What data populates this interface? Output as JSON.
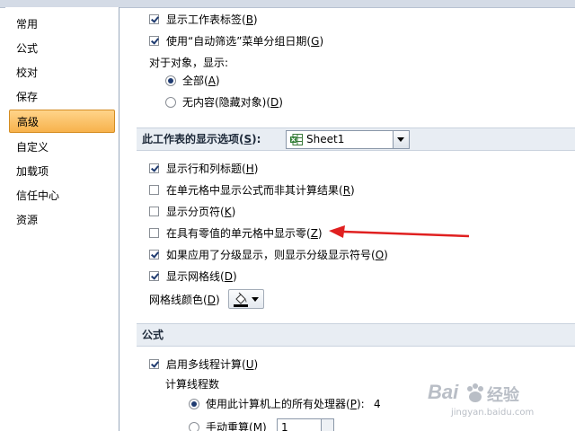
{
  "sidebar": {
    "items": [
      {
        "label": "常用"
      },
      {
        "label": "公式"
      },
      {
        "label": "校对"
      },
      {
        "label": "保存"
      },
      {
        "label": "高级",
        "active": true
      },
      {
        "label": "自定义"
      },
      {
        "label": "加载项"
      },
      {
        "label": "信任中心"
      },
      {
        "label": "资源"
      }
    ]
  },
  "workbook_options": {
    "show_sheet_tabs": {
      "text": "显示工作表标签(",
      "key": "B",
      "end": ")",
      "checked": true
    },
    "group_dates": {
      "text": "使用“自动筛选”菜单分组日期(",
      "key": "G",
      "end": ")",
      "checked": true
    },
    "objects_label": "对于对象，显示:",
    "show_all": {
      "text": "全部(",
      "key": "A",
      "end": ")",
      "selected": true
    },
    "show_none": {
      "text": "无内容(隐藏对象)(",
      "key": "D",
      "end": ")",
      "selected": false
    }
  },
  "sheet_section": {
    "title_pre": "此工作表的显示选项(",
    "title_key": "S",
    "title_post": "):",
    "selected_sheet": "Sheet1",
    "options": [
      {
        "text": "显示行和列标题(",
        "key": "H",
        "end": ")",
        "checked": true
      },
      {
        "text": "在单元格中显示公式而非其计算结果(",
        "key": "R",
        "end": ")",
        "checked": false
      },
      {
        "text": "显示分页符(",
        "key": "K",
        "end": ")",
        "checked": false
      },
      {
        "text": "在具有零值的单元格中显示零(",
        "key": "Z",
        "end": ")",
        "checked": false
      },
      {
        "text": "如果应用了分级显示，则显示分级显示符号(",
        "key": "O",
        "end": ")",
        "checked": true
      },
      {
        "text": "显示网格线(",
        "key": "D",
        "end": ")",
        "checked": true
      }
    ],
    "gridline_color_label": {
      "text": "网格线颜色(",
      "key": "D",
      "end": ")"
    }
  },
  "formula_section": {
    "title": "公式",
    "multithread": {
      "text": "启用多线程计算(",
      "key": "U",
      "end": ")",
      "checked": true
    },
    "threads_label": "计算线程数",
    "use_all": {
      "text": "使用此计算机上的所有处理器(",
      "key": "P",
      "end": "):",
      "value": "4",
      "selected": true
    },
    "manual": {
      "text": "手动重算(",
      "key": "M",
      "end": ")",
      "value": "1",
      "selected": false
    }
  },
  "annotation": {
    "arrow_color": "#e02020"
  },
  "watermark": {
    "brand": "Bai",
    "brand2": "经验",
    "url": "jingyan.baidu.com"
  },
  "colors": {
    "active_tab": "#f7b24c",
    "section_bg": "#e8edf3",
    "check": "#1f3b70"
  }
}
